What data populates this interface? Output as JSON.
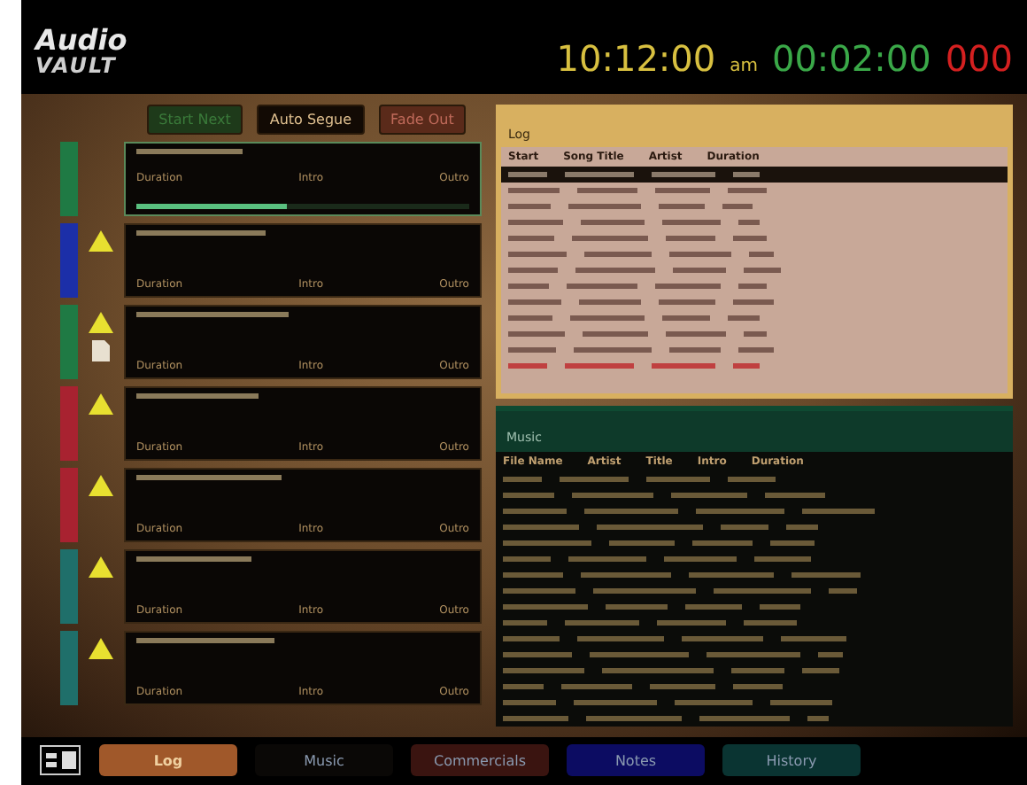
{
  "header": {
    "logo_top": "Audio",
    "logo_bottom": "VAULT",
    "clock": "10:12:00",
    "clock_suffix": "am",
    "countdown": "00:02:00",
    "counter": "000"
  },
  "controls": [
    {
      "label": "Start Next",
      "kind": "start"
    },
    {
      "label": "Auto Segue",
      "kind": "segue"
    },
    {
      "label": "Fade Out",
      "kind": "fade"
    }
  ],
  "cards": [
    {
      "color": "#1f7a44",
      "warning": false,
      "note": false,
      "playing": true,
      "level": 0.45,
      "duration": "Duration",
      "intro": "Intro",
      "outro": "Outro"
    },
    {
      "color": "#1c2fa8",
      "warning": true,
      "note": false,
      "playing": false,
      "duration": "Duration",
      "intro": "Intro",
      "outro": "Outro"
    },
    {
      "color": "#1f7a44",
      "warning": true,
      "note": true,
      "playing": false,
      "duration": "Duration",
      "intro": "Intro",
      "outro": "Outro"
    },
    {
      "color": "#a82230",
      "warning": true,
      "note": false,
      "playing": false,
      "duration": "Duration",
      "intro": "Intro",
      "outro": "Outro"
    },
    {
      "color": "#a82230",
      "warning": true,
      "note": false,
      "playing": false,
      "duration": "Duration",
      "intro": "Intro",
      "outro": "Outro"
    },
    {
      "color": "#1f6f6a",
      "warning": true,
      "note": false,
      "playing": false,
      "duration": "Duration",
      "intro": "Intro",
      "outro": "Outro"
    },
    {
      "color": "#1f6f6a",
      "warning": true,
      "note": false,
      "playing": false,
      "duration": "Duration",
      "intro": "Intro",
      "outro": "Outro"
    }
  ],
  "log": {
    "title": "Log",
    "columns": [
      "Start",
      "Song Title",
      "Artist",
      "Duration"
    ],
    "rows": [
      {
        "selected": true,
        "alert": false
      },
      {
        "selected": false,
        "alert": false
      },
      {
        "selected": false,
        "alert": false
      },
      {
        "selected": false,
        "alert": false
      },
      {
        "selected": false,
        "alert": false
      },
      {
        "selected": false,
        "alert": false
      },
      {
        "selected": false,
        "alert": false
      },
      {
        "selected": false,
        "alert": false
      },
      {
        "selected": false,
        "alert": false
      },
      {
        "selected": false,
        "alert": false
      },
      {
        "selected": false,
        "alert": false
      },
      {
        "selected": false,
        "alert": false
      },
      {
        "selected": false,
        "alert": true
      }
    ]
  },
  "music": {
    "title": "Music",
    "columns": [
      "File Name",
      "Artist",
      "Title",
      "Intro",
      "Duration"
    ]
  },
  "tabs": [
    {
      "label": "Log",
      "selected": true,
      "color": "#a0582a"
    },
    {
      "label": "Music",
      "selected": false,
      "color": "#0a0806"
    },
    {
      "label": "Commercials",
      "selected": false,
      "color": "#3a1410"
    },
    {
      "label": "Notes",
      "selected": false,
      "color": "#0c0c62"
    },
    {
      "label": "History",
      "selected": false,
      "color": "#0a3432"
    }
  ]
}
